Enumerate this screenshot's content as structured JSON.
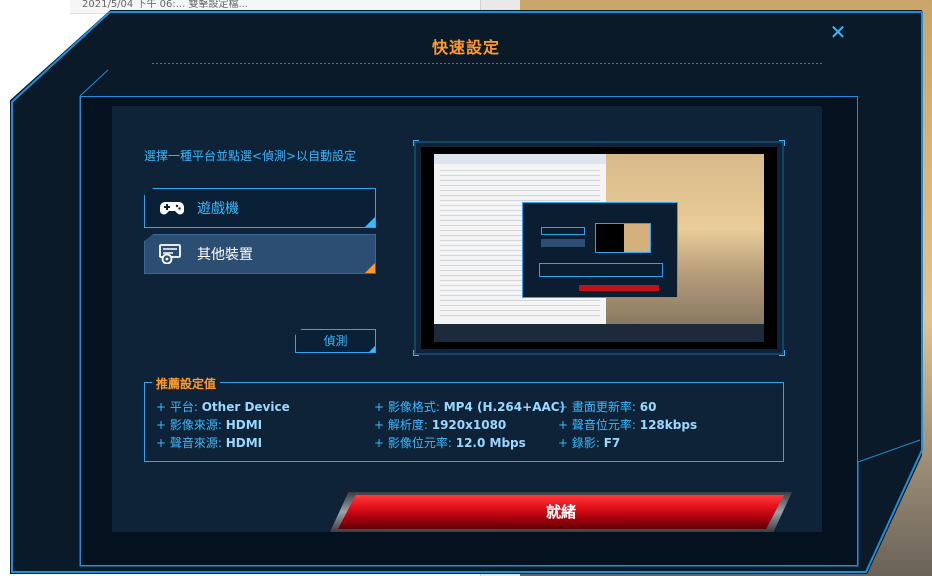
{
  "background": {
    "left_strip_text": "2021/5/04 下午 06:...  雙擊設定檔..."
  },
  "dialog": {
    "title": "快速設定",
    "close_label": "✕"
  },
  "instruction": "選擇一種平台並點選<偵測>以自動設定",
  "devices": [
    {
      "label": "遊戲機",
      "icon": "gamepad-icon",
      "selected": false
    },
    {
      "label": "其他裝置",
      "icon": "device-icon",
      "selected": true
    }
  ],
  "detect_label": "偵測",
  "recommended": {
    "title": "推薦設定值",
    "items": [
      {
        "key": "+ 平台: ",
        "value": "Other Device"
      },
      {
        "key": "+ 影像來源: ",
        "value": "HDMI"
      },
      {
        "key": "+ 聲音來源: ",
        "value": "HDMI"
      },
      {
        "key": "+ 影像格式: ",
        "value": "MP4 (H.264+AAC)"
      },
      {
        "key": "+ 解析度: ",
        "value": "1920x1080"
      },
      {
        "key": "+ 影像位元率: ",
        "value": "12.0 Mbps"
      },
      {
        "key": "+ 畫面更新率: ",
        "value": "60"
      },
      {
        "key": "+ 聲音位元率: ",
        "value": "128kbps"
      },
      {
        "key": "+ 錄影: ",
        "value": "F7"
      }
    ]
  },
  "done_label": "就緒",
  "colors": {
    "accent_blue": "#39b9ff",
    "accent_orange": "#ff9a2a",
    "done_red": "#e3101a"
  }
}
